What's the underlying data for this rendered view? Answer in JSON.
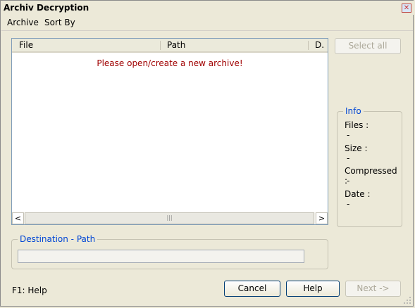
{
  "window": {
    "title": "Archiv Decryption",
    "close_glyph": "✕"
  },
  "menu": {
    "items": [
      {
        "label": "Archive"
      },
      {
        "label": "Sort By"
      }
    ]
  },
  "list": {
    "columns": [
      {
        "label": "File"
      },
      {
        "label": "Path"
      },
      {
        "label": "D."
      }
    ],
    "empty_message": "Please open/create a new archive!",
    "scroll": {
      "left_glyph": "<",
      "right_glyph": ">",
      "thumb_glyph": "|||"
    }
  },
  "buttons": {
    "select_all": "Select all",
    "cancel": "Cancel",
    "help": "Help",
    "next": "Next ->"
  },
  "info": {
    "legend": "Info",
    "files_label": "Files :",
    "files_value": "-",
    "size_label": "Size :",
    "size_value": "-",
    "compressed_label": "Compressed :",
    "compressed_value": "-",
    "date_label": "Date :",
    "date_value": "-"
  },
  "destination": {
    "legend": "Destination - Path",
    "value": ""
  },
  "status": {
    "help_hint": "F1: Help"
  },
  "colors": {
    "legend": "#0046d5",
    "empty_message": "#a00000"
  }
}
